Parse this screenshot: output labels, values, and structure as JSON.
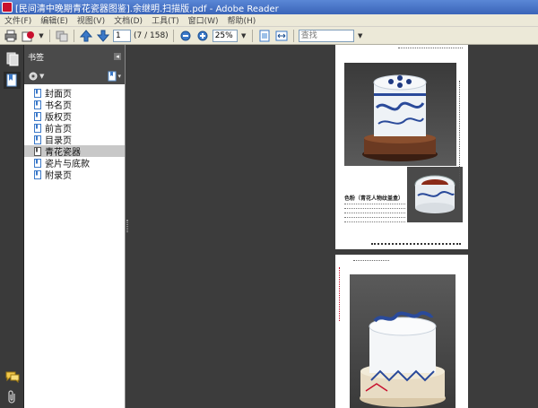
{
  "window": {
    "title": "[民间清中晚期青花瓷器图鉴].余继明.扫描版.pdf - Adobe Reader"
  },
  "menu": [
    "文件(F)",
    "编辑(E)",
    "视图(V)",
    "文档(D)",
    "工具(T)",
    "窗口(W)",
    "帮助(H)"
  ],
  "toolbar": {
    "page_value": "1",
    "page_total": "(7 / 158)",
    "zoom_value": "25%",
    "search_placeholder": "查找"
  },
  "panel": {
    "title": "书签",
    "bookmarks": [
      "封面页",
      "书名页",
      "版权页",
      "前言页",
      "目录页",
      "青花瓷器",
      "瓷片与底款",
      "附录页"
    ],
    "selected_index": 5
  },
  "document": {
    "page1_caption_title": "色粉（青花人物纹盖盒）"
  },
  "colors": {
    "titlebar": "#3a64b8",
    "panel_header": "#4a4a4a",
    "doc_bg": "#3c3c3c",
    "accent": "#c8102e"
  }
}
